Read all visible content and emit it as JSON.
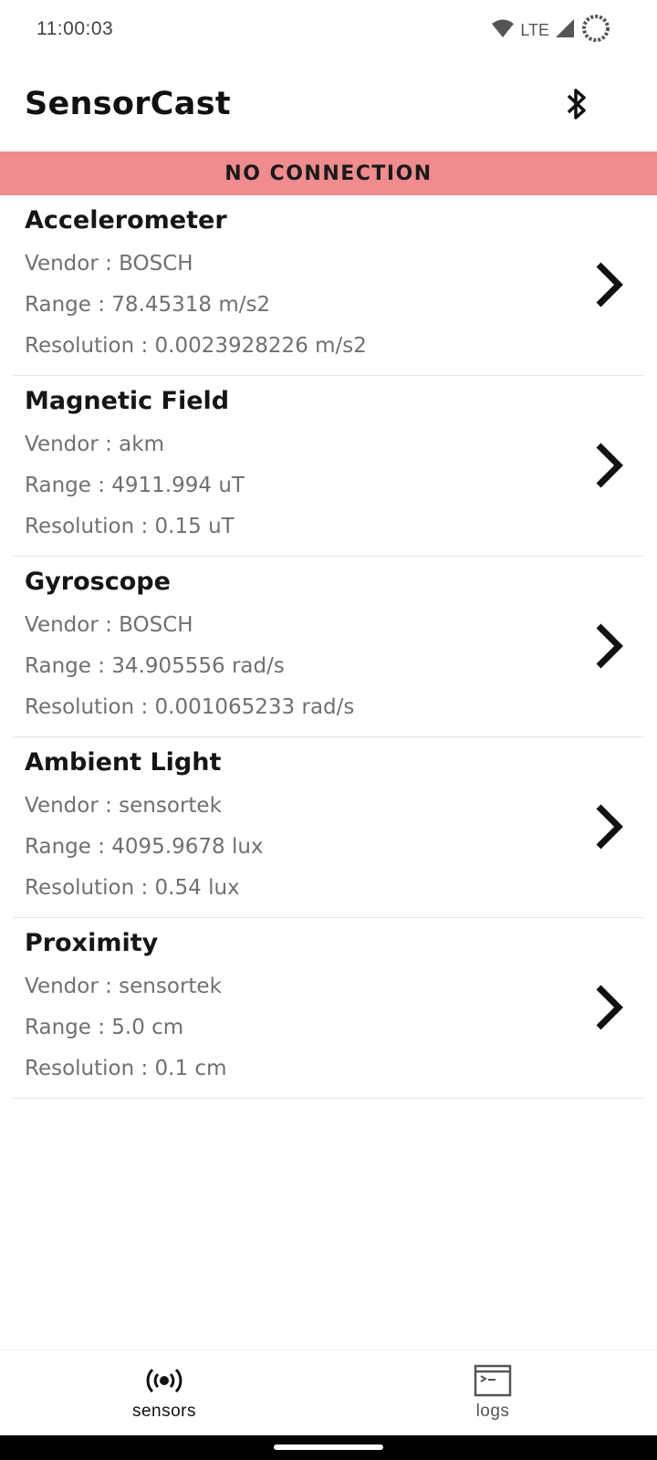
{
  "status_bar": {
    "time": "11:00:03",
    "network_label": "LTE",
    "icons": [
      "wifi-icon",
      "signal-icon",
      "battery-icon"
    ]
  },
  "app": {
    "title": "SensorCast",
    "bluetooth_icon": "bluetooth-icon"
  },
  "banner": {
    "text": "NO CONNECTION",
    "color": "#f08c8e"
  },
  "sensors": [
    {
      "name": "Accelerometer",
      "vendor": "Vendor : BOSCH",
      "range": "Range : 78.45318 m/s2",
      "resolution": "Resolution : 0.0023928226 m/s2"
    },
    {
      "name": "Magnetic Field",
      "vendor": "Vendor : akm",
      "range": "Range : 4911.994 uT",
      "resolution": "Resolution : 0.15 uT"
    },
    {
      "name": "Gyroscope",
      "vendor": "Vendor : BOSCH",
      "range": "Range : 34.905556 rad/s",
      "resolution": "Resolution : 0.001065233 rad/s"
    },
    {
      "name": "Ambient Light",
      "vendor": "Vendor : sensortek",
      "range": "Range : 4095.9678 lux",
      "resolution": "Resolution : 0.54 lux"
    },
    {
      "name": "Proximity",
      "vendor": "Vendor : sensortek",
      "range": "Range : 5.0 cm",
      "resolution": "Resolution : 0.1 cm"
    }
  ],
  "bottom_nav": {
    "items": [
      {
        "label": "sensors",
        "icon": "sensors-icon",
        "active": true
      },
      {
        "label": "logs",
        "icon": "terminal-icon",
        "active": false
      }
    ]
  }
}
